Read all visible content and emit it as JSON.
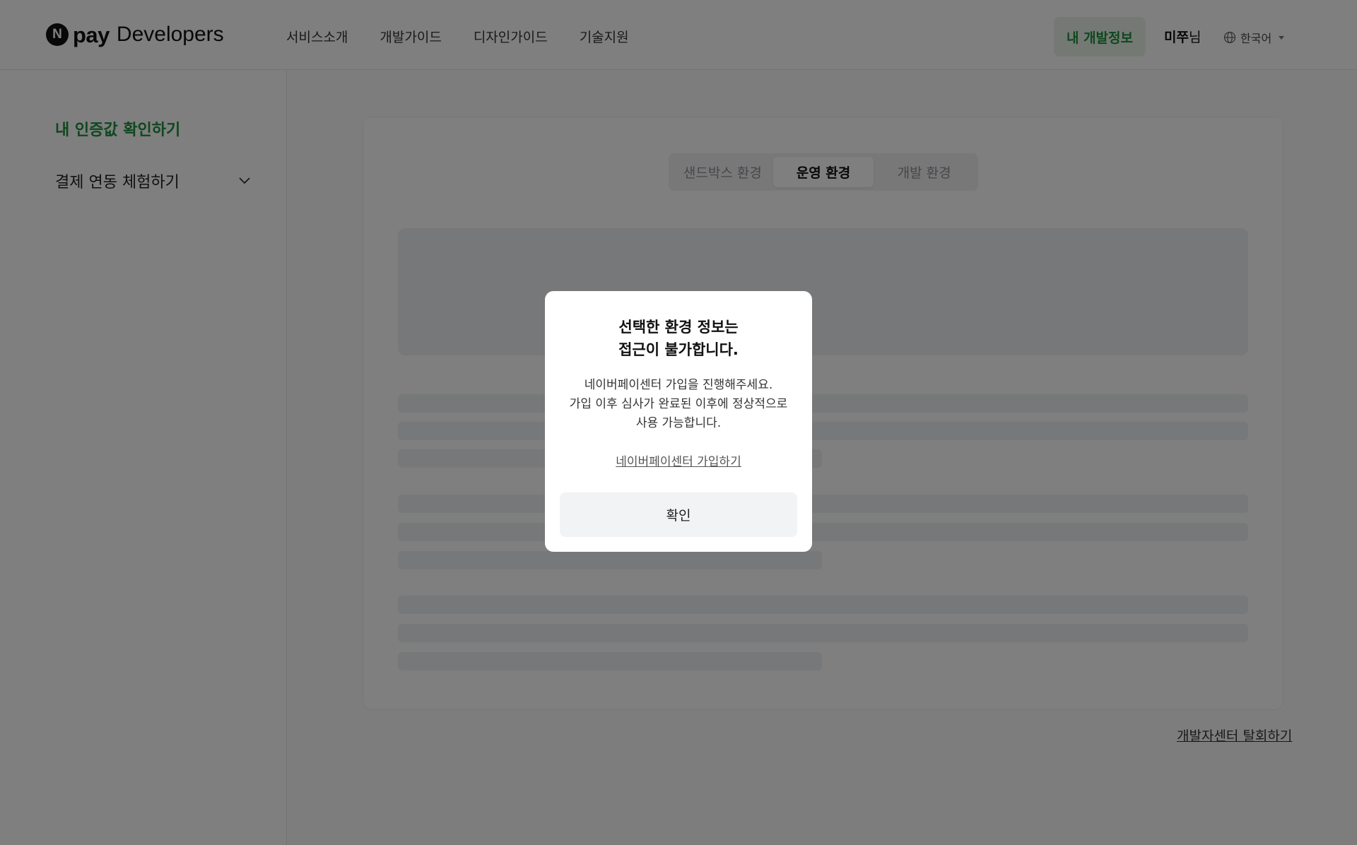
{
  "header": {
    "logo": {
      "brand": "pay",
      "suffix": "Developers",
      "badge": "N"
    },
    "nav": [
      "서비스소개",
      "개발가이드",
      "디자인가이드",
      "기술지원"
    ],
    "my_dev_info": "내 개발정보",
    "user": {
      "name": "미쭈",
      "suffix": "님"
    },
    "language": "한국어"
  },
  "sidebar": {
    "active_item": "내 인증값 확인하기",
    "items": [
      {
        "label": "결제 연동 체험하기"
      }
    ]
  },
  "main": {
    "tabs": [
      {
        "label": "샌드박스 환경",
        "active": false
      },
      {
        "label": "운영 환경",
        "active": true
      },
      {
        "label": "개발 환경",
        "active": false
      }
    ],
    "withdraw_link": "개발자센터 탈회하기"
  },
  "modal": {
    "title_line1": "선택한 환경 정보는",
    "title_line2": "접근이 불가합니다.",
    "body_line1": "네이버페이센터 가입을 진행해주세요.",
    "body_line2": "가입 이후 심사가 완료된 이후에 정상적으로",
    "body_line3": "사용 가능합니다.",
    "link": "네이버페이센터 가입하기",
    "confirm": "확인"
  },
  "colors": {
    "accent_green": "#1e8f3c",
    "accent_green_bg": "#e8f3e9",
    "overlay": "rgba(0,0,0,0.5)"
  }
}
